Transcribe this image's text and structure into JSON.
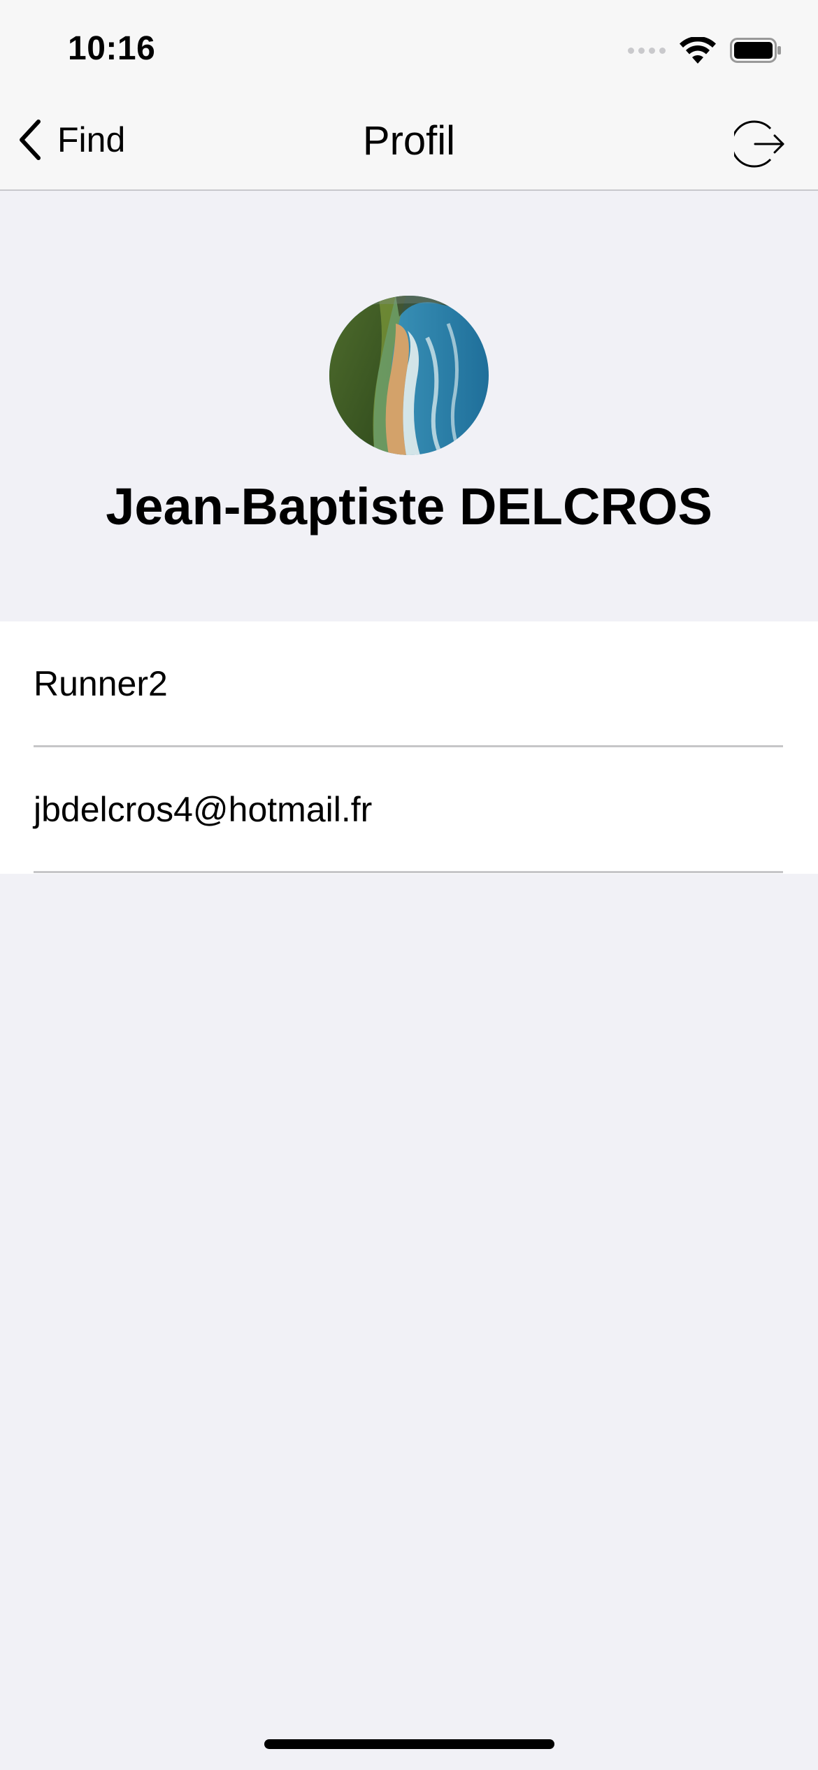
{
  "status_bar": {
    "time": "10:16"
  },
  "nav": {
    "back_label": "Find",
    "title": "Profil",
    "icons": {
      "back": "chevron-left-icon",
      "logout": "logout-icon"
    }
  },
  "profile": {
    "name": "Jean-Baptiste DELCROS",
    "avatar": "coastline-beach-photo"
  },
  "info": {
    "username": "Runner2",
    "email": "jbdelcros4@hotmail.fr"
  },
  "colors": {
    "background": "#f1f1f6",
    "nav_background": "#f7f7f7",
    "separator": "#c6c6c8",
    "text": "#000000"
  }
}
